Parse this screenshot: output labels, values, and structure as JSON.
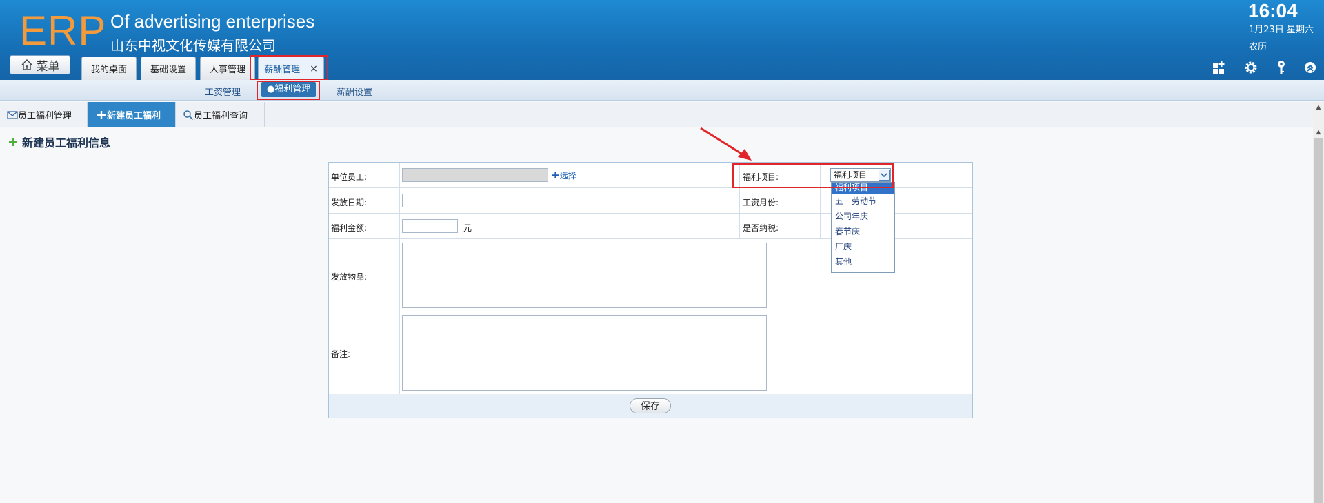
{
  "header": {
    "logo": "ERP",
    "company_en": "Of advertising enterprises",
    "company_cn": "山东中视文化传媒有限公司",
    "time": "16:04",
    "date": "1月23日 星期六",
    "lunar": "农历",
    "menu_label": "菜单",
    "tabs": [
      {
        "label": "我的桌面"
      },
      {
        "label": "基础设置"
      },
      {
        "label": "人事管理"
      },
      {
        "label": "薪酬管理",
        "close": "×"
      }
    ],
    "icons": [
      "grid-add-icon",
      "gear-icon",
      "key-icon",
      "collapse-up-icon"
    ]
  },
  "subnav": {
    "items": [
      {
        "label": "工资管理"
      },
      {
        "label": "●福利管理"
      },
      {
        "label": "薪酬设置"
      }
    ]
  },
  "tooltabs": {
    "items": [
      {
        "label": "员工福利管理"
      },
      {
        "label": "新建员工福利"
      },
      {
        "label": "员工福利查询"
      }
    ]
  },
  "page": {
    "title": "新建员工福利信息"
  },
  "form": {
    "employee_label": "单位员工:",
    "employee_value": "",
    "select_link": "选择",
    "issue_date_label": "发放日期:",
    "issue_date_value": "",
    "amount_label": "福利金额:",
    "amount_value": "",
    "amount_unit": "元",
    "items_label": "发放物品:",
    "items_value": "",
    "note_label": "备注:",
    "note_value": "",
    "welfare_item_label": "福利项目:",
    "salary_month_label": "工资月份:",
    "taxable_label": "是否纳税:",
    "save_label": "保存"
  },
  "dropdown": {
    "selected": "福利项目",
    "options": [
      "福利项目",
      "五一劳动节",
      "公司年庆",
      "春节庆",
      "厂庆",
      "其他"
    ]
  },
  "colors": {
    "header_bg": "#1a7bc4",
    "logo": "#f39a3c",
    "highlight_box": "#e0262b",
    "active_tab": "#2e86c8"
  }
}
